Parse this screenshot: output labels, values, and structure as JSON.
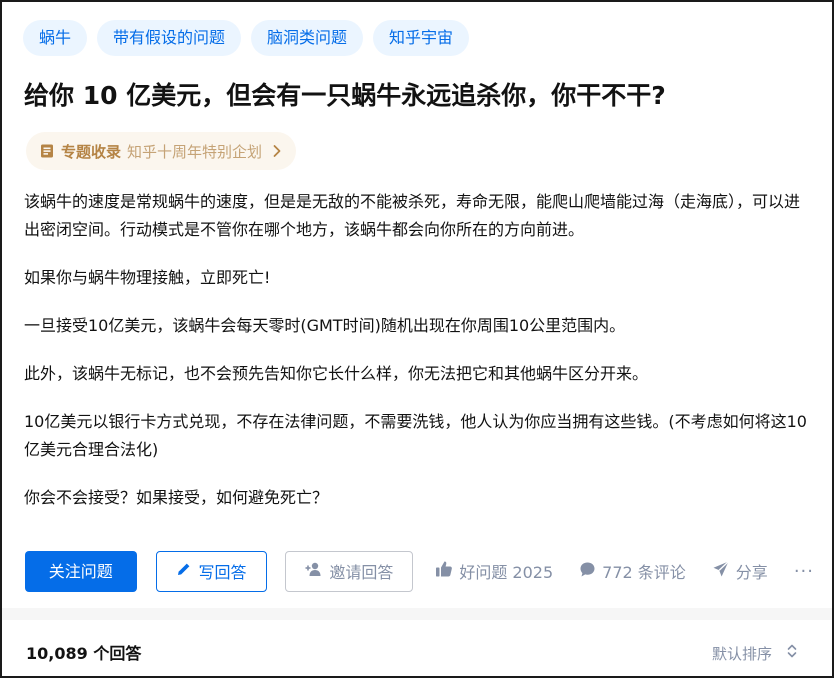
{
  "topics": [
    "蜗牛",
    "带有假设的问题",
    "脑洞类问题",
    "知乎宇宙"
  ],
  "question": {
    "title": "给你 10 亿美元，但会有一只蜗牛永远追杀你，你干不干?",
    "collection_label": "专题收录",
    "collection_name": "知乎十周年特别企划",
    "paragraphs": [
      "该蜗牛的速度是常规蜗牛的速度，但是是无敌的不能被杀死，寿命无限，能爬山爬墙能过海（走海底），可以进出密闭空间。行动模式是不管你在哪个地方，该蜗牛都会向你所在的方向前进。",
      "如果你与蜗牛物理接触，立即死亡!",
      "一旦接受10亿美元，该蜗牛会每天零时(GMT时间)随机出现在你周围10公里范围内。",
      "此外，该蜗牛无标记，也不会预先告知你它长什么样，你无法把它和其他蜗牛区分开来。",
      "10亿美元以银行卡方式兑现，不存在法律问题，不需要洗钱，他人认为你应当拥有这些钱。(不考虑如何将这10亿美元合理合法化)",
      "你会不会接受？如果接受，如何避免死亡？"
    ]
  },
  "actions": {
    "follow": "关注问题",
    "write_answer": "写回答",
    "invite": "邀请回答",
    "good_question": "好问题 2025",
    "comments": "772 条评论",
    "share": "分享",
    "more": "···"
  },
  "answers": {
    "count_label": "10,089 个回答",
    "sort_label": "默认排序"
  },
  "colors": {
    "brand_blue": "#056de8",
    "topic_bg": "#ebf5ff",
    "meta_gray": "#8590a6",
    "collection_gold": "#b58445"
  },
  "icons": [
    "doc-icon",
    "chevron-right-icon",
    "pen-icon",
    "add-user-icon",
    "thumb-up-icon",
    "comment-icon",
    "send-icon",
    "sort-icon"
  ]
}
